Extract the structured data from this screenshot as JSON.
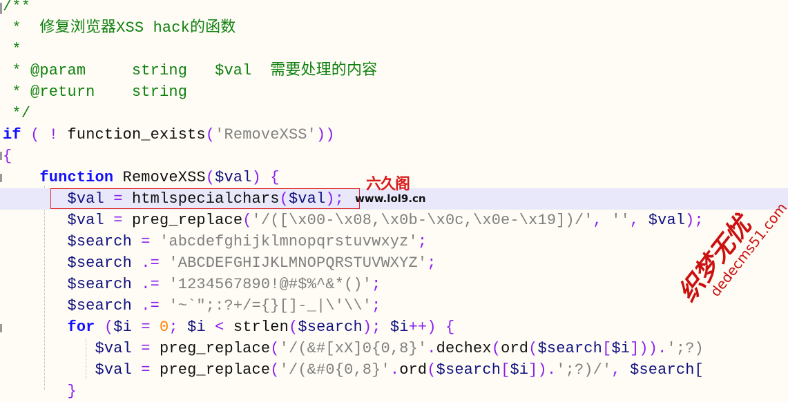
{
  "editor": {
    "language": "PHP",
    "colors": {
      "comment": "#108010",
      "keyword": "#1010ff",
      "variable": "#101080",
      "operator": "#8a1ef0",
      "string": "#808080",
      "number": "#ff8000",
      "current_line": "#e8e8fa",
      "selection": "#c0c0c0",
      "selection_border": "#e02828",
      "background": "#fefcf4"
    },
    "lines": [
      {
        "tokens": [
          {
            "t": "cm",
            "v": "/**"
          }
        ]
      },
      {
        "tokens": [
          {
            "t": "cm",
            "v": " *  修复浏览器XSS hack的函数"
          }
        ]
      },
      {
        "tokens": [
          {
            "t": "cm",
            "v": " *"
          }
        ]
      },
      {
        "tokens": [
          {
            "t": "cm",
            "v": " * @param     string   $val  需要处理的内容"
          }
        ]
      },
      {
        "tokens": [
          {
            "t": "cm",
            "v": " * @return    string"
          }
        ]
      },
      {
        "tokens": [
          {
            "t": "cm",
            "v": " */"
          }
        ]
      },
      {
        "tokens": [
          {
            "t": "kw",
            "v": "if"
          },
          {
            "t": "op",
            "v": " ( ! "
          },
          {
            "t": "fn",
            "v": "function_exists"
          },
          {
            "t": "op",
            "v": "("
          },
          {
            "t": "str",
            "v": "'RemoveXSS'"
          },
          {
            "t": "op",
            "v": "))"
          }
        ]
      },
      {
        "tokens": [
          {
            "t": "op",
            "v": "{"
          }
        ]
      },
      {
        "tokens": [
          {
            "t": "fn",
            "v": "    "
          },
          {
            "t": "kw",
            "v": "function"
          },
          {
            "t": "fn",
            "v": " RemoveXSS"
          },
          {
            "t": "op",
            "v": "("
          },
          {
            "t": "var",
            "v": "$val"
          },
          {
            "t": "op",
            "v": ")"
          },
          {
            "t": "fn",
            "v": " "
          },
          {
            "t": "op",
            "v": "{"
          }
        ]
      },
      {
        "current": true,
        "tokens": [
          {
            "t": "fn",
            "v": "       "
          },
          {
            "t": "var",
            "v": "$val"
          },
          {
            "t": "op",
            "v": " = "
          },
          {
            "t": "fn",
            "v": "htmlspecialchars"
          },
          {
            "t": "op",
            "v": "("
          },
          {
            "t": "var",
            "v": "$val"
          },
          {
            "t": "op",
            "v": ");"
          }
        ]
      },
      {
        "tokens": [
          {
            "t": "fn",
            "v": "       "
          },
          {
            "t": "var",
            "v": "$val"
          },
          {
            "t": "op",
            "v": " = "
          },
          {
            "t": "fn",
            "v": "preg_replace"
          },
          {
            "t": "op",
            "v": "("
          },
          {
            "t": "str",
            "v": "'/([\\x00-\\x08,\\x0b-\\x0c,\\x0e-\\x19])/'"
          },
          {
            "t": "op",
            "v": ", "
          },
          {
            "t": "str",
            "v": "''"
          },
          {
            "t": "op",
            "v": ", "
          },
          {
            "t": "var",
            "v": "$val"
          },
          {
            "t": "op",
            "v": ");"
          }
        ]
      },
      {
        "tokens": [
          {
            "t": "fn",
            "v": "       "
          },
          {
            "t": "var",
            "v": "$search"
          },
          {
            "t": "op",
            "v": " = "
          },
          {
            "t": "str",
            "v": "'abcdefghijklmnopqrstuvwxyz'"
          },
          {
            "t": "op",
            "v": ";"
          }
        ]
      },
      {
        "tokens": [
          {
            "t": "fn",
            "v": "       "
          },
          {
            "t": "var",
            "v": "$search"
          },
          {
            "t": "op",
            "v": " .= "
          },
          {
            "t": "str",
            "v": "'ABCDEFGHIJKLMNOPQRSTUVWXYZ'"
          },
          {
            "t": "op",
            "v": ";"
          }
        ]
      },
      {
        "tokens": [
          {
            "t": "fn",
            "v": "       "
          },
          {
            "t": "var",
            "v": "$search"
          },
          {
            "t": "op",
            "v": " .= "
          },
          {
            "t": "str",
            "v": "'1234567890!@#$%^&*()'"
          },
          {
            "t": "op",
            "v": ";"
          }
        ]
      },
      {
        "tokens": [
          {
            "t": "fn",
            "v": "       "
          },
          {
            "t": "var",
            "v": "$search"
          },
          {
            "t": "op",
            "v": " .= "
          },
          {
            "t": "str",
            "v": "'~`\";:?+/={}[]-_|\\'\\\\'"
          },
          {
            "t": "op",
            "v": ";"
          }
        ]
      },
      {
        "tokens": [
          {
            "t": "fn",
            "v": "       "
          },
          {
            "t": "kw",
            "v": "for"
          },
          {
            "t": "op",
            "v": " ("
          },
          {
            "t": "var",
            "v": "$i"
          },
          {
            "t": "op",
            "v": " = "
          },
          {
            "t": "num",
            "v": "0"
          },
          {
            "t": "op",
            "v": "; "
          },
          {
            "t": "var",
            "v": "$i"
          },
          {
            "t": "op",
            "v": " < "
          },
          {
            "t": "fn",
            "v": "strlen"
          },
          {
            "t": "op",
            "v": "("
          },
          {
            "t": "var",
            "v": "$search"
          },
          {
            "t": "op",
            "v": "); "
          },
          {
            "t": "var",
            "v": "$i"
          },
          {
            "t": "op",
            "v": "++) {"
          }
        ]
      },
      {
        "tokens": [
          {
            "t": "fn",
            "v": "          "
          },
          {
            "t": "var",
            "v": "$val"
          },
          {
            "t": "op",
            "v": " = "
          },
          {
            "t": "fn",
            "v": "preg_replace"
          },
          {
            "t": "op",
            "v": "("
          },
          {
            "t": "str",
            "v": "'/(&#[xX]0{0,8}'"
          },
          {
            "t": "op",
            "v": "."
          },
          {
            "t": "fn",
            "v": "dechex"
          },
          {
            "t": "op",
            "v": "("
          },
          {
            "t": "fn",
            "v": "ord"
          },
          {
            "t": "op",
            "v": "("
          },
          {
            "t": "var",
            "v": "$search"
          },
          {
            "t": "op",
            "v": "["
          },
          {
            "t": "var",
            "v": "$i"
          },
          {
            "t": "op",
            "v": "]))."
          },
          {
            "t": "str",
            "v": "';?)"
          }
        ]
      },
      {
        "tokens": [
          {
            "t": "fn",
            "v": "          "
          },
          {
            "t": "var",
            "v": "$val"
          },
          {
            "t": "op",
            "v": " = "
          },
          {
            "t": "fn",
            "v": "preg_replace"
          },
          {
            "t": "op",
            "v": "("
          },
          {
            "t": "str",
            "v": "'/(&#0{0,8}'"
          },
          {
            "t": "op",
            "v": "."
          },
          {
            "t": "fn",
            "v": "ord"
          },
          {
            "t": "op",
            "v": "("
          },
          {
            "t": "var",
            "v": "$search"
          },
          {
            "t": "op",
            "v": "["
          },
          {
            "t": "var",
            "v": "$i"
          },
          {
            "t": "op",
            "v": "])."
          },
          {
            "t": "str",
            "v": "';?)/'"
          },
          {
            "t": "op",
            "v": ", "
          },
          {
            "t": "var",
            "v": "$search["
          }
        ]
      },
      {
        "tokens": [
          {
            "t": "fn",
            "v": "       "
          },
          {
            "t": "op",
            "v": "}"
          }
        ]
      }
    ]
  },
  "watermarks": {
    "top": {
      "brand": "六久阁",
      "url": "www.lol9.cn"
    },
    "bottom": {
      "brand": "织梦无忧",
      "url": "dedecms51.com"
    }
  }
}
